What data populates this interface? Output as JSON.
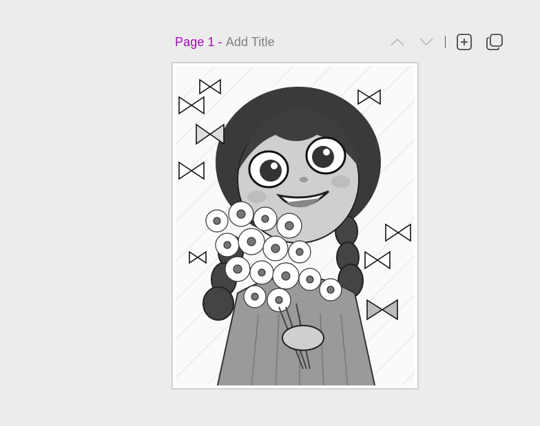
{
  "page_header": {
    "page_label": "Page 1",
    "separator": "-",
    "title_placeholder": "Add Title"
  },
  "toolbar": {
    "move_up_icon": "chevron-up-icon",
    "move_down_icon": "chevron-down-icon",
    "add_page_icon": "add-page-icon",
    "duplicate_page_icon": "duplicate-page-icon"
  },
  "colors": {
    "accent": "#a10ab5",
    "placeholder": "#7f7f7f",
    "background": "#ececec"
  },
  "canvas": {
    "image_description_icon": "coloring-page-illustration"
  }
}
